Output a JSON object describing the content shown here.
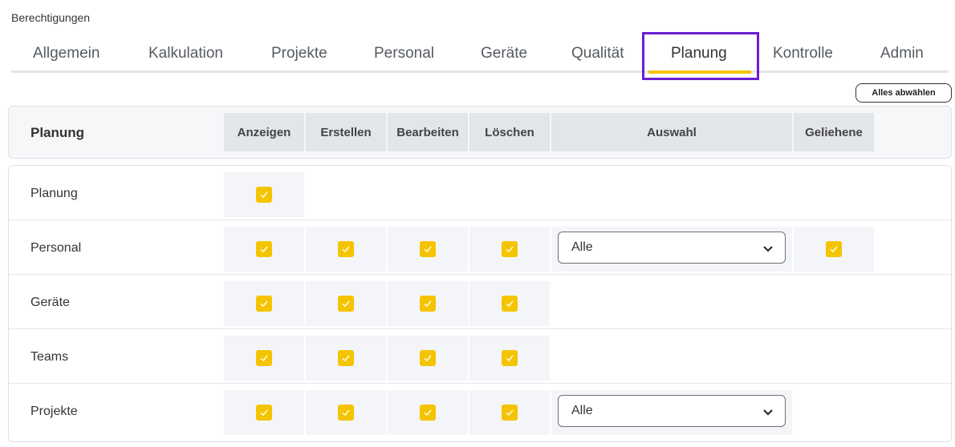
{
  "page": {
    "title": "Berechtigungen"
  },
  "tabs": [
    {
      "label": "Allgemein"
    },
    {
      "label": "Kalkulation"
    },
    {
      "label": "Projekte"
    },
    {
      "label": "Personal"
    },
    {
      "label": "Geräte"
    },
    {
      "label": "Qualität"
    },
    {
      "label": "Planung",
      "active": true
    },
    {
      "label": "Kontrolle"
    },
    {
      "label": "Admin"
    }
  ],
  "toolbar": {
    "deselect_all_label": "Alles abwählen"
  },
  "table": {
    "section_title": "Planung",
    "columns": [
      "Anzeigen",
      "Erstellen",
      "Bearbeiten",
      "Löschen",
      "Auswahl",
      "Geliehene"
    ],
    "rows": [
      {
        "label": "Planung",
        "anzeigen": true
      },
      {
        "label": "Personal",
        "anzeigen": true,
        "erstellen": true,
        "bearbeiten": true,
        "loeschen": true,
        "auswahl": "Alle",
        "geliehene": true
      },
      {
        "label": "Geräte",
        "anzeigen": true,
        "erstellen": true,
        "bearbeiten": true,
        "loeschen": true
      },
      {
        "label": "Teams",
        "anzeigen": true,
        "erstellen": true,
        "bearbeiten": true,
        "loeschen": true
      },
      {
        "label": "Projekte",
        "anzeigen": true,
        "erstellen": true,
        "bearbeiten": true,
        "loeschen": true,
        "auswahl": "Alle"
      }
    ]
  },
  "colors": {
    "accent": "#f5c400",
    "highlight": "#6a1fd1"
  }
}
